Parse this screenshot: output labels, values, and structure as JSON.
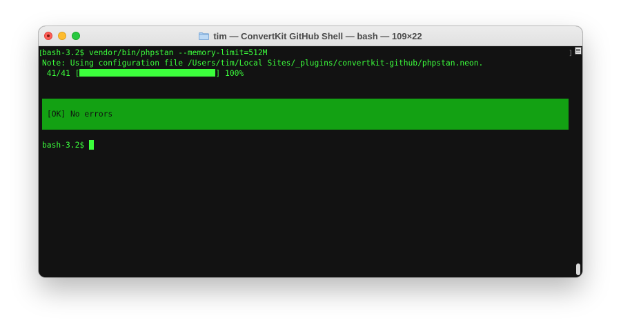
{
  "window": {
    "title": "tim — ConvertKit GitHub Shell — bash — 109×22",
    "folder_icon": "folder-icon",
    "colors": {
      "background": "#121212",
      "text": "#3cff3c",
      "ok_box": "#13a113"
    }
  },
  "terminal": {
    "line1": "bash-3.2$ vendor/bin/phpstan --memory-limit=512M",
    "line2": "Note: Using configuration file /Users/tim/Local Sites/_plugins/convertkit-github/phpstan.neon.",
    "progress": {
      "prefix": " 41/41 [",
      "suffix": "] 100%",
      "percent": 100
    },
    "ok_message": "[OK] No errors",
    "prompt": "bash-3.2$ "
  }
}
